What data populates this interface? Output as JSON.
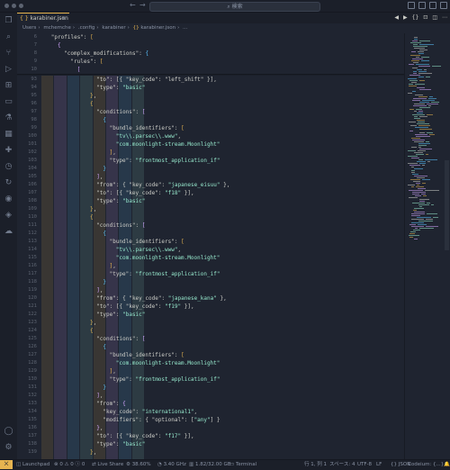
{
  "window": {
    "search_placeholder": "検索"
  },
  "tab": {
    "label": "karabiner.json",
    "close": "×",
    "icon": "{ }"
  },
  "breadcrumb": [
    "Users",
    "mchemche",
    ".config",
    "karabiner",
    "karabiner.json",
    "..."
  ],
  "code": {
    "sticky": [
      {
        "ln": "6",
        "indent": 3,
        "parts": [
          [
            "k",
            "\"profiles\""
          ],
          [
            "sy",
            ": "
          ],
          [
            "b1",
            "["
          ]
        ]
      },
      {
        "ln": "7",
        "indent": 5,
        "parts": [
          [
            "b2",
            "{"
          ]
        ]
      },
      {
        "ln": "8",
        "indent": 7,
        "parts": [
          [
            "k",
            "\"complex_modifications\""
          ],
          [
            "sy",
            ": "
          ],
          [
            "b3",
            "{"
          ]
        ]
      },
      {
        "ln": "9",
        "indent": 9,
        "parts": [
          [
            "k",
            "\"rules\""
          ],
          [
            "sy",
            ": "
          ],
          [
            "b1",
            "["
          ]
        ]
      },
      {
        "ln": "10",
        "indent": 11,
        "parts": [
          [
            "b2",
            "["
          ]
        ]
      }
    ],
    "lines": [
      {
        "ln": "93",
        "indent": 17,
        "parts": [
          [
            "k",
            "\"to\""
          ],
          [
            "sy",
            ": [{ \"key_code\": \"left_shift\" }],"
          ]
        ]
      },
      {
        "ln": "94",
        "indent": 17,
        "parts": [
          [
            "k",
            "\"type\""
          ],
          [
            "sy",
            ": "
          ],
          [
            "s",
            "\"basic\""
          ]
        ]
      },
      {
        "ln": "95",
        "indent": 15,
        "parts": [
          [
            "b1",
            "}"
          ],
          [
            "sy",
            ","
          ]
        ]
      },
      {
        "ln": "96",
        "indent": 15,
        "parts": [
          [
            "b1",
            "{"
          ]
        ]
      },
      {
        "ln": "97",
        "indent": 17,
        "parts": [
          [
            "k",
            "\"conditions\""
          ],
          [
            "sy",
            ": "
          ],
          [
            "b2",
            "["
          ]
        ]
      },
      {
        "ln": "98",
        "indent": 19,
        "parts": [
          [
            "b3",
            "{"
          ]
        ]
      },
      {
        "ln": "99",
        "indent": 21,
        "parts": [
          [
            "k",
            "\"bundle_identifiers\""
          ],
          [
            "sy",
            ": "
          ],
          [
            "b1",
            "["
          ]
        ]
      },
      {
        "ln": "100",
        "indent": 23,
        "parts": [
          [
            "s",
            "\"tv\\\\.parsec\\\\.www\""
          ],
          [
            "sy",
            ","
          ]
        ]
      },
      {
        "ln": "101",
        "indent": 23,
        "parts": [
          [
            "s",
            "\"com.moonlight-stream.Moonlight\""
          ]
        ]
      },
      {
        "ln": "102",
        "indent": 21,
        "parts": [
          [
            "b1",
            "]"
          ],
          [
            "sy",
            ","
          ]
        ]
      },
      {
        "ln": "103",
        "indent": 21,
        "parts": [
          [
            "k",
            "\"type\""
          ],
          [
            "sy",
            ": "
          ],
          [
            "s",
            "\"frontmost_application_if\""
          ]
        ]
      },
      {
        "ln": "104",
        "indent": 19,
        "parts": [
          [
            "b3",
            "}"
          ]
        ]
      },
      {
        "ln": "105",
        "indent": 17,
        "parts": [
          [
            "b2",
            "]"
          ],
          [
            "sy",
            ","
          ]
        ]
      },
      {
        "ln": "106",
        "indent": 17,
        "parts": [
          [
            "k",
            "\"from\""
          ],
          [
            "sy",
            ": { "
          ],
          [
            "k",
            "\"key_code\""
          ],
          [
            "sy",
            ": "
          ],
          [
            "s",
            "\"japanese_eisuu\""
          ],
          [
            "sy",
            " },"
          ]
        ]
      },
      {
        "ln": "107",
        "indent": 17,
        "parts": [
          [
            "k",
            "\"to\""
          ],
          [
            "sy",
            ": [{ "
          ],
          [
            "k",
            "\"key_code\""
          ],
          [
            "sy",
            ": "
          ],
          [
            "s",
            "\"f18\""
          ],
          [
            "sy",
            " }],"
          ]
        ]
      },
      {
        "ln": "108",
        "indent": 17,
        "parts": [
          [
            "k",
            "\"type\""
          ],
          [
            "sy",
            ": "
          ],
          [
            "s",
            "\"basic\""
          ]
        ]
      },
      {
        "ln": "109",
        "indent": 15,
        "parts": [
          [
            "b1",
            "}"
          ],
          [
            "sy",
            ","
          ]
        ]
      },
      {
        "ln": "110",
        "indent": 15,
        "parts": [
          [
            "b1",
            "{"
          ]
        ]
      },
      {
        "ln": "111",
        "indent": 17,
        "parts": [
          [
            "k",
            "\"conditions\""
          ],
          [
            "sy",
            ": "
          ],
          [
            "b2",
            "["
          ]
        ]
      },
      {
        "ln": "112",
        "indent": 19,
        "parts": [
          [
            "b3",
            "{"
          ]
        ]
      },
      {
        "ln": "113",
        "indent": 21,
        "parts": [
          [
            "k",
            "\"bundle_identifiers\""
          ],
          [
            "sy",
            ": "
          ],
          [
            "b1",
            "["
          ]
        ]
      },
      {
        "ln": "114",
        "indent": 23,
        "parts": [
          [
            "s",
            "\"tv\\\\.parsec\\\\.www\""
          ],
          [
            "sy",
            ","
          ]
        ]
      },
      {
        "ln": "115",
        "indent": 23,
        "parts": [
          [
            "s",
            "\"com.moonlight-stream.Moonlight\""
          ]
        ]
      },
      {
        "ln": "116",
        "indent": 21,
        "parts": [
          [
            "b1",
            "]"
          ],
          [
            "sy",
            ","
          ]
        ]
      },
      {
        "ln": "117",
        "indent": 21,
        "parts": [
          [
            "k",
            "\"type\""
          ],
          [
            "sy",
            ": "
          ],
          [
            "s",
            "\"frontmost_application_if\""
          ]
        ]
      },
      {
        "ln": "118",
        "indent": 19,
        "parts": [
          [
            "b3",
            "}"
          ]
        ]
      },
      {
        "ln": "119",
        "indent": 17,
        "parts": [
          [
            "b2",
            "]"
          ],
          [
            "sy",
            ","
          ]
        ]
      },
      {
        "ln": "120",
        "indent": 17,
        "parts": [
          [
            "k",
            "\"from\""
          ],
          [
            "sy",
            ": { "
          ],
          [
            "k",
            "\"key_code\""
          ],
          [
            "sy",
            ": "
          ],
          [
            "s",
            "\"japanese_kana\""
          ],
          [
            "sy",
            " },"
          ]
        ]
      },
      {
        "ln": "121",
        "indent": 17,
        "parts": [
          [
            "k",
            "\"to\""
          ],
          [
            "sy",
            ": [{ "
          ],
          [
            "k",
            "\"key_code\""
          ],
          [
            "sy",
            ": "
          ],
          [
            "s",
            "\"f19\""
          ],
          [
            "sy",
            " }],"
          ]
        ]
      },
      {
        "ln": "122",
        "indent": 17,
        "parts": [
          [
            "k",
            "\"type\""
          ],
          [
            "sy",
            ": "
          ],
          [
            "s",
            "\"basic\""
          ]
        ]
      },
      {
        "ln": "123",
        "indent": 15,
        "parts": [
          [
            "b1",
            "}"
          ],
          [
            "sy",
            ","
          ]
        ]
      },
      {
        "ln": "124",
        "indent": 15,
        "parts": [
          [
            "b1",
            "{"
          ]
        ]
      },
      {
        "ln": "125",
        "indent": 17,
        "parts": [
          [
            "k",
            "\"conditions\""
          ],
          [
            "sy",
            ": "
          ],
          [
            "b2",
            "["
          ]
        ]
      },
      {
        "ln": "126",
        "indent": 19,
        "parts": [
          [
            "b3",
            "{"
          ]
        ]
      },
      {
        "ln": "127",
        "indent": 21,
        "parts": [
          [
            "k",
            "\"bundle_identifiers\""
          ],
          [
            "sy",
            ": "
          ],
          [
            "b1",
            "["
          ]
        ]
      },
      {
        "ln": "128",
        "indent": 23,
        "parts": [
          [
            "s",
            "\"com.moonlight-stream.Moonlight\""
          ]
        ]
      },
      {
        "ln": "129",
        "indent": 21,
        "parts": [
          [
            "b1",
            "]"
          ],
          [
            "sy",
            ","
          ]
        ]
      },
      {
        "ln": "130",
        "indent": 21,
        "parts": [
          [
            "k",
            "\"type\""
          ],
          [
            "sy",
            ": "
          ],
          [
            "s",
            "\"frontmost_application_if\""
          ]
        ]
      },
      {
        "ln": "131",
        "indent": 19,
        "parts": [
          [
            "b3",
            "}"
          ]
        ]
      },
      {
        "ln": "132",
        "indent": 17,
        "parts": [
          [
            "b2",
            "]"
          ],
          [
            "sy",
            ","
          ]
        ]
      },
      {
        "ln": "133",
        "indent": 17,
        "parts": [
          [
            "k",
            "\"from\""
          ],
          [
            "sy",
            ": "
          ],
          [
            "b2",
            "{"
          ]
        ]
      },
      {
        "ln": "134",
        "indent": 19,
        "parts": [
          [
            "k",
            "\"key_code\""
          ],
          [
            "sy",
            ": "
          ],
          [
            "s",
            "\"international1\""
          ],
          [
            "sy",
            ","
          ]
        ]
      },
      {
        "ln": "135",
        "indent": 19,
        "parts": [
          [
            "k",
            "\"modifiers\""
          ],
          [
            "sy",
            ": { "
          ],
          [
            "k",
            "\"optional\""
          ],
          [
            "sy",
            ": ["
          ],
          [
            "s",
            "\"any\""
          ],
          [
            "sy",
            "] }"
          ]
        ]
      },
      {
        "ln": "136",
        "indent": 17,
        "parts": [
          [
            "b2",
            "}"
          ],
          [
            "sy",
            ","
          ]
        ]
      },
      {
        "ln": "137",
        "indent": 17,
        "parts": [
          [
            "k",
            "\"to\""
          ],
          [
            "sy",
            ": [{ "
          ],
          [
            "k",
            "\"key_code\""
          ],
          [
            "sy",
            ": "
          ],
          [
            "s",
            "\"f17\""
          ],
          [
            "sy",
            " }],"
          ]
        ]
      },
      {
        "ln": "138",
        "indent": 17,
        "parts": [
          [
            "k",
            "\"type\""
          ],
          [
            "sy",
            ": "
          ],
          [
            "s",
            "\"basic\""
          ]
        ]
      },
      {
        "ln": "139",
        "indent": 15,
        "parts": [
          [
            "b1",
            "}"
          ],
          [
            "sy",
            ","
          ]
        ]
      }
    ]
  },
  "statusbar": {
    "remote": "⨉",
    "launchpad": "Launchpad",
    "errors": "0",
    "warnings": "0",
    "info": "0",
    "live_share": "Live Share",
    "cpu": "38.60%",
    "freq": "3.40 GHz",
    "mem": "1.82/32.00 GB",
    "terminal": "Terminal",
    "position": "行 1, 列 1",
    "spaces": "スペース: 4",
    "encoding": "UTF-8",
    "eol": "LF",
    "language": "JSON",
    "codeium": "Codeium: {...}"
  },
  "colors": {
    "background": "#1f2430",
    "accent": "#e6b450",
    "string": "#95e6cb"
  }
}
